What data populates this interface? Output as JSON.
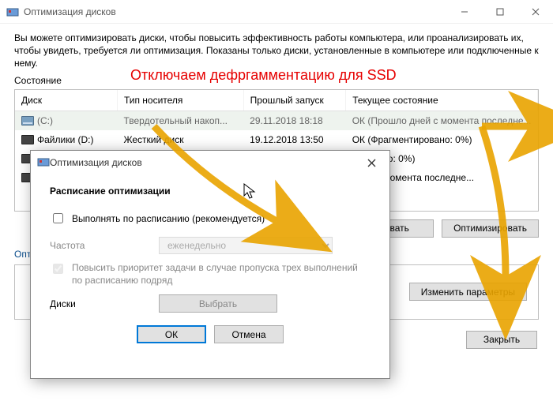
{
  "window": {
    "title": "Оптимизация дисков",
    "intro": "Вы можете оптимизировать диски, чтобы повысить эффективность работы  компьютера, или проанализировать их, чтобы увидеть, требуется ли оптимизация. Показаны только диски, установленные в компьютере или подключенные к нему.",
    "state_label": "Состояние",
    "annotation": "Отключаем дефргамментацию для SSD"
  },
  "table": {
    "headers": [
      "Диск",
      "Тип носителя",
      "Прошлый запуск",
      "Текущее состояние"
    ],
    "rows": [
      {
        "name": "(C:)",
        "media": "Твердотельный накоп...",
        "last": "29.11.2018 18:18",
        "status": "ОК (Прошло дней с момента последне..."
      },
      {
        "name": "Файлики (D:)",
        "media": "Жесткий диск",
        "last": "19.12.2018 13:50",
        "status": "ОК (Фрагментировано: 0%)"
      },
      {
        "name": "",
        "media": "",
        "last": "",
        "status": "тировано: 0%)"
      },
      {
        "name": "",
        "media": "",
        "last": "",
        "status": "дней с момента последне..."
      }
    ]
  },
  "buttons": {
    "analyze": "ровать",
    "optimize": "Оптимизировать",
    "change_params": "Изменить параметры",
    "close": "Закрыть"
  },
  "schedule_section": {
    "heading": "Опти"
  },
  "modal": {
    "title": "Оптимизация дисков",
    "heading": "Расписание оптимизации",
    "checkbox_label": "Выполнять по расписанию (рекомендуется)",
    "freq_label": "Частота",
    "freq_value": "еженедельно",
    "priority_label": "Повысить приоритет задачи в случае пропуска трех выполнений по расписанию подряд",
    "disks_label": "Диски",
    "choose_btn": "Выбрать",
    "ok": "ОК",
    "cancel": "Отмена"
  }
}
